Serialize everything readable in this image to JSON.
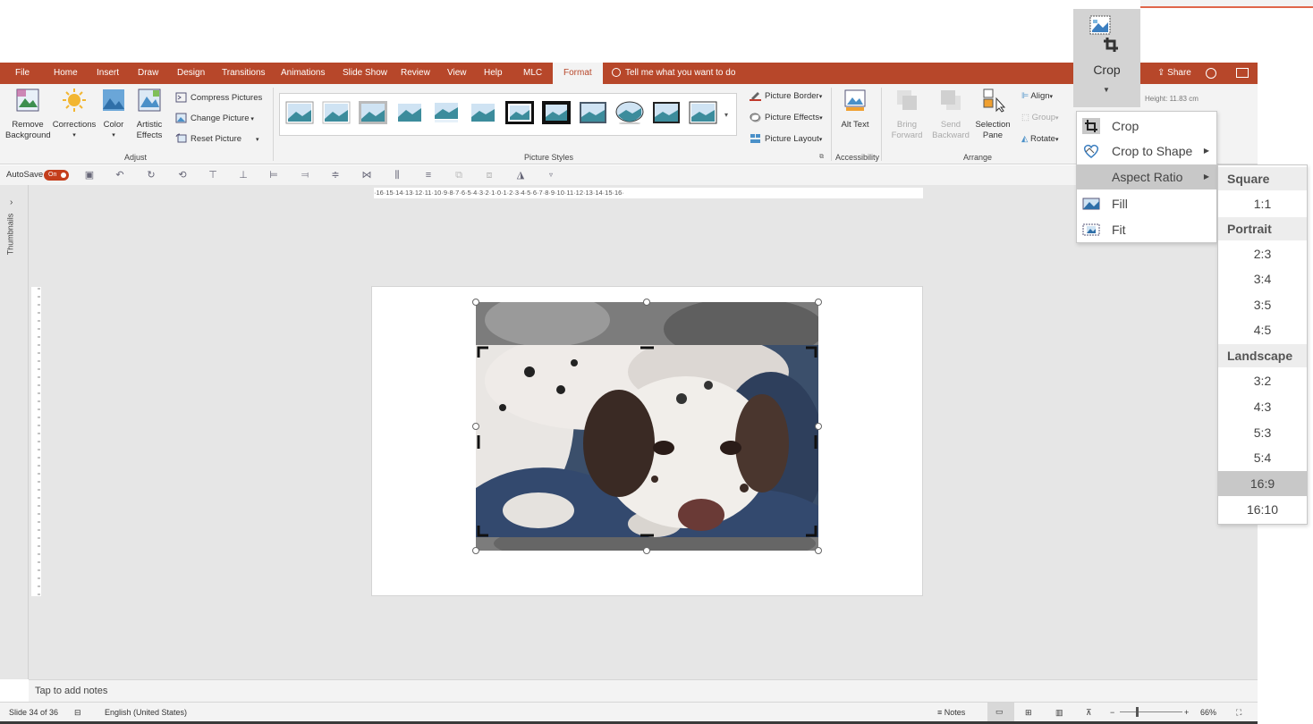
{
  "ribbon_tabs": [
    {
      "label": "File"
    },
    {
      "label": "Home"
    },
    {
      "label": "Insert"
    },
    {
      "label": "Draw"
    },
    {
      "label": "Design"
    },
    {
      "label": "Transitions"
    },
    {
      "label": "Animations"
    },
    {
      "label": "Slide Show"
    },
    {
      "label": "Review"
    },
    {
      "label": "View"
    },
    {
      "label": "Help"
    },
    {
      "label": "MLC"
    },
    {
      "label": "Format"
    }
  ],
  "active_tab": "Format",
  "tell_me": "Tell me what you want to do",
  "share": "Share",
  "adjust": {
    "remove_background": "Remove Background",
    "corrections": "Corrections",
    "color": "Color",
    "artistic_effects": "Artistic Effects",
    "compress_pictures": "Compress Pictures",
    "change_picture": "Change Picture",
    "reset_picture": "Reset Picture",
    "group_label": "Adjust"
  },
  "picture_styles": {
    "group_label": "Picture Styles",
    "picture_border": "Picture Border",
    "picture_effects": "Picture Effects",
    "picture_layout": "Picture Layout"
  },
  "accessibility": {
    "alt_text": "Alt Text",
    "group_label": "Accessibility"
  },
  "arrange": {
    "bring_forward": "Bring Forward",
    "send_backward": "Send Backward",
    "selection_pane": "Selection Pane",
    "align": "Align",
    "group": "Group",
    "rotate": "Rotate",
    "group_label": "Arrange"
  },
  "size": {
    "crop": "Crop",
    "height_value": "11.83 cm"
  },
  "qat": {
    "autosave": "AutoSave",
    "toggle": "On"
  },
  "thumbnails": "Thumbnails",
  "hruler_text": "·16·15·14·13·12·11·10·9·8·7·6·5·4·3·2·1·0·1·2·3·4·5·6·7·8·9·10·11·12·13·14·15·16·",
  "notes_placeholder": "Tap to add notes",
  "status": {
    "slide": "Slide 34 of 36",
    "language": "English (United States)",
    "notes": "Notes",
    "zoom": "66%"
  },
  "crop_menu": [
    {
      "label": "Crop"
    },
    {
      "label": "Crop to Shape"
    },
    {
      "label": "Aspect Ratio"
    },
    {
      "label": "Fill"
    },
    {
      "label": "Fit"
    }
  ],
  "aspect_ratio_menu": {
    "square_header": "Square",
    "square": [
      "1:1"
    ],
    "portrait_header": "Portrait",
    "portrait": [
      "2:3",
      "3:4",
      "3:5",
      "4:5"
    ],
    "landscape_header": "Landscape",
    "landscape": [
      "3:2",
      "4:3",
      "5:3",
      "5:4",
      "16:9",
      "16:10"
    ],
    "selected": "16:9"
  },
  "colors": {
    "accent": "#b7472a",
    "ribbon": "#f3f3f3",
    "workspace": "#e6e6e6",
    "highlight": "#c8c8c8"
  }
}
